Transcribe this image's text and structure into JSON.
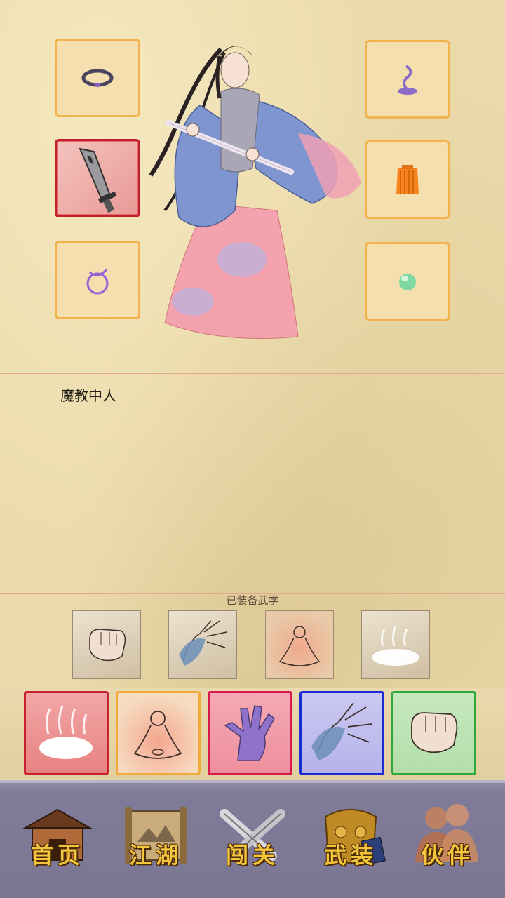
{
  "character": {
    "description": "魔教中人"
  },
  "equipment_slots": [
    {
      "slot": "left-1",
      "item_icon": "ring-icon"
    },
    {
      "slot": "left-2",
      "item_icon": "broadsword-icon",
      "selected": true
    },
    {
      "slot": "left-3",
      "item_icon": "cord-icon"
    },
    {
      "slot": "right-1",
      "item_icon": "incense-icon"
    },
    {
      "slot": "right-2",
      "item_icon": "robe-icon"
    },
    {
      "slot": "right-3",
      "item_icon": "jade-icon"
    }
  ],
  "martial_arts": {
    "equipped_title": "已装备武学",
    "equipped": [
      {
        "icon": "fist-icon"
      },
      {
        "icon": "open-palm-icon"
      },
      {
        "icon": "meditation-icon"
      },
      {
        "icon": "mist-icon"
      }
    ],
    "available": [
      {
        "icon": "mist-icon",
        "border_color": "#c8202e"
      },
      {
        "icon": "meditation-icon",
        "border_color": "#f2a93b"
      },
      {
        "icon": "claw-icon",
        "border_color": "#d9184e"
      },
      {
        "icon": "open-palm-icon",
        "border_color": "#1a2ad6"
      },
      {
        "icon": "fist-icon",
        "border_color": "#2fa83a"
      }
    ]
  },
  "nav": [
    {
      "label": "首页",
      "icon": "house-icon"
    },
    {
      "label": "江湖",
      "icon": "scroll-icon"
    },
    {
      "label": "闯关",
      "icon": "crossed-swords-icon"
    },
    {
      "label": "武装",
      "icon": "armor-icon"
    },
    {
      "label": "伙伴",
      "icon": "companions-icon"
    }
  ]
}
